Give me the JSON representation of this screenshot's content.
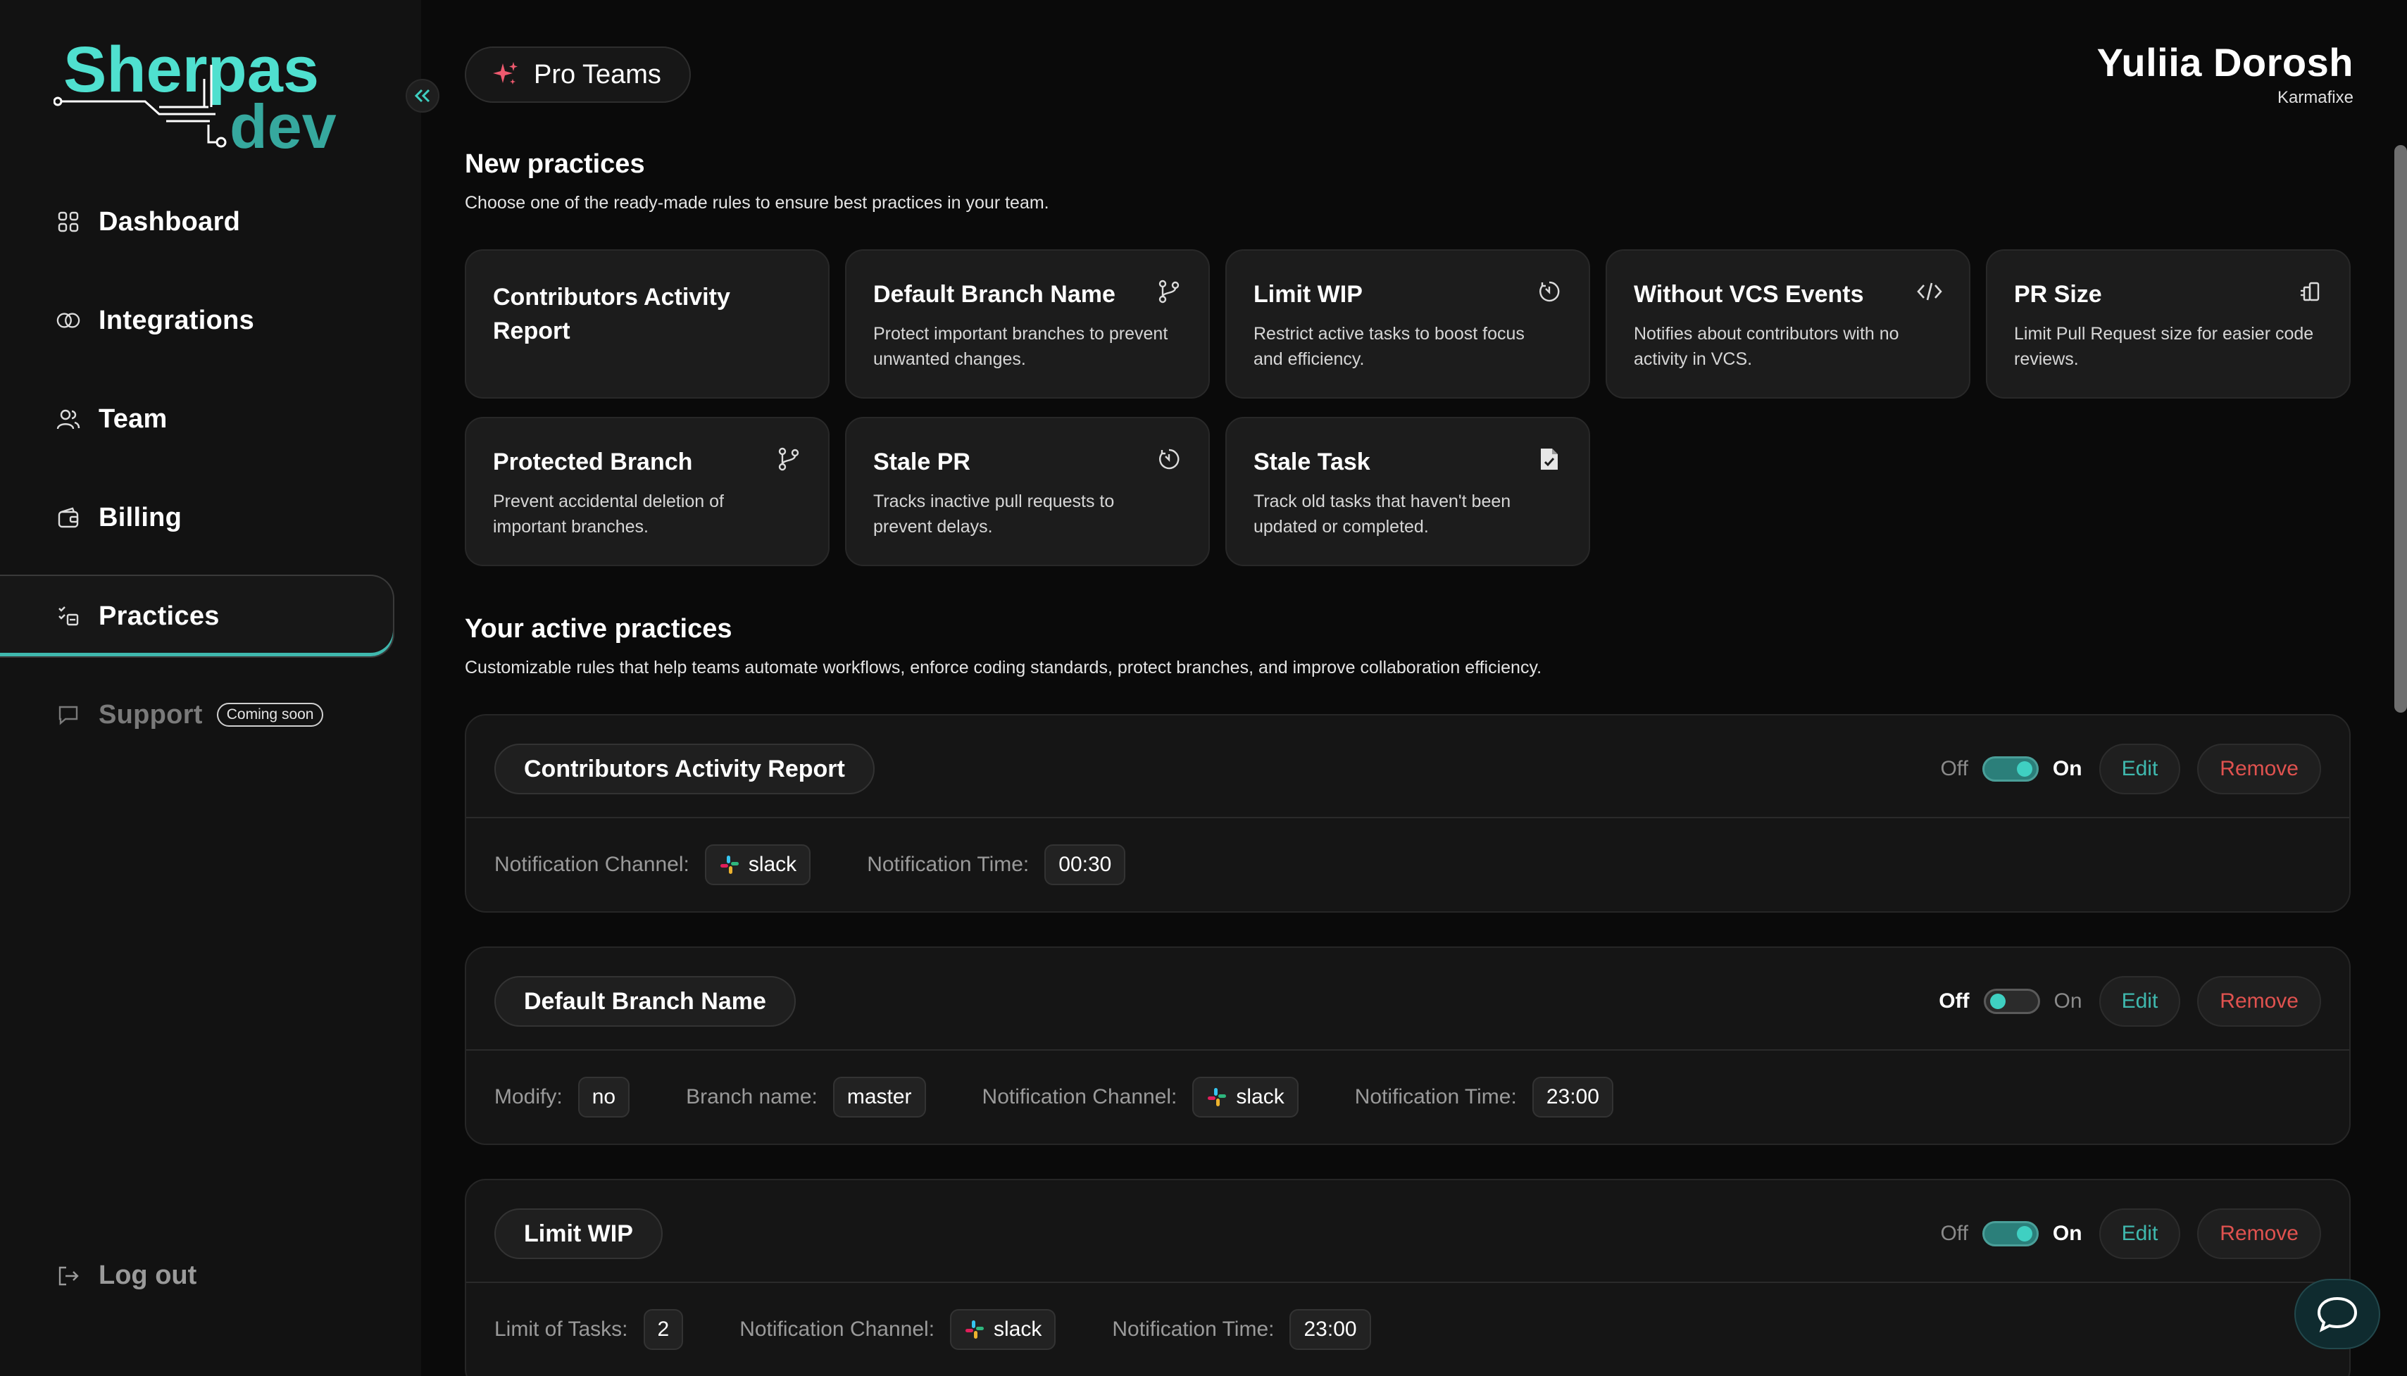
{
  "sidebar": {
    "logo_text_top": "Sherpas",
    "logo_text_bottom": "dev",
    "items": [
      {
        "label": "Dashboard",
        "icon": "grid-icon"
      },
      {
        "label": "Integrations",
        "icon": "rings-icon"
      },
      {
        "label": "Team",
        "icon": "users-icon"
      },
      {
        "label": "Billing",
        "icon": "wallet-icon"
      },
      {
        "label": "Practices",
        "icon": "practices-icon",
        "active": true
      },
      {
        "label": "Support",
        "icon": "chat-bubble-icon",
        "badge": "Coming soon",
        "disabled": true
      }
    ],
    "logout_label": "Log out"
  },
  "header": {
    "plan_label": "Pro Teams",
    "user_name": "Yuliia Dorosh",
    "user_company": "Karmafixe"
  },
  "new_practices": {
    "title": "New practices",
    "subtitle": "Choose one of the ready-made rules to ensure best practices in your team.",
    "cards": [
      {
        "title": "Contributors Activity Report",
        "desc": "",
        "icon": ""
      },
      {
        "title": "Default Branch Name",
        "desc": "Protect important branches to prevent unwanted changes.",
        "icon": "branch-icon"
      },
      {
        "title": "Limit WIP",
        "desc": "Restrict active tasks to boost focus and efficiency.",
        "icon": "timer-icon"
      },
      {
        "title": "Without VCS Events",
        "desc": "Notifies about contributors with no activity in VCS.",
        "icon": "code-icon"
      },
      {
        "title": "PR Size",
        "desc": "Limit Pull Request size for easier code reviews.",
        "icon": "size-icon"
      },
      {
        "title": "Protected Branch",
        "desc": "Prevent accidental deletion of important branches.",
        "icon": "branch-icon"
      },
      {
        "title": "Stale PR",
        "desc": "Tracks inactive pull requests to prevent delays.",
        "icon": "timer-icon"
      },
      {
        "title": "Stale Task",
        "desc": "Track old tasks that haven't been updated or completed.",
        "icon": "file-check-icon"
      }
    ]
  },
  "active_practices": {
    "title": "Your active practices",
    "subtitle": "Customizable rules that help teams automate workflows, enforce coding standards, protect branches, and improve collaboration efficiency.",
    "off_label": "Off",
    "on_label": "On",
    "edit_label": "Edit",
    "remove_label": "Remove",
    "items": [
      {
        "name": "Contributors Activity Report",
        "enabled": true,
        "fields": [
          {
            "label": "Notification Channel:",
            "value": "slack",
            "slack": true
          },
          {
            "label": "Notification Time:",
            "value": "00:30"
          }
        ]
      },
      {
        "name": "Default Branch Name",
        "enabled": false,
        "fields": [
          {
            "label": "Modify:",
            "value": "no"
          },
          {
            "label": "Branch name:",
            "value": "master"
          },
          {
            "label": "Notification Channel:",
            "value": "slack",
            "slack": true
          },
          {
            "label": "Notification Time:",
            "value": "23:00"
          }
        ]
      },
      {
        "name": "Limit WIP",
        "enabled": true,
        "fields": [
          {
            "label": "Limit of Tasks:",
            "value": "2"
          },
          {
            "label": "Notification Channel:",
            "value": "slack",
            "slack": true
          },
          {
            "label": "Notification Time:",
            "value": "23:00"
          }
        ]
      }
    ]
  },
  "colors": {
    "accent": "#3fd0c2",
    "remove": "#e0524f",
    "background": "#0a0a0a",
    "sidebar": "#121212"
  }
}
